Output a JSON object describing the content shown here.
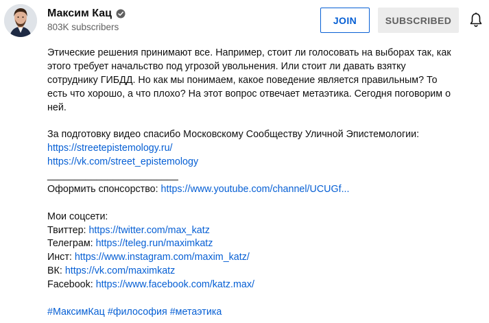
{
  "channel": {
    "name": "Максим Кац",
    "subscribers": "803K subscribers"
  },
  "buttons": {
    "join": "JOIN",
    "subscribed": "SUBSCRIBED"
  },
  "icons": {
    "verified": "verified-check-icon",
    "bell": "bell-icon"
  },
  "colors": {
    "link": "#065fd4",
    "join_border": "#065fd4",
    "subscribed_bg": "#ececec",
    "secondary_text": "#606060"
  },
  "description": {
    "paragraph": [
      "Этические решения принимают все. Например, стоит ли голосовать на выборах так, как",
      "этого требует начальство под угрозой увольнения. Или стоит ли давать взятку",
      "сотруднику ГИБДД. Но как мы понимаем, какое поведение является правильным? То",
      "есть что хорошо, а что плохо? На этот вопрос отвечает метаэтика. Сегодня поговорим о",
      "ней."
    ],
    "thanks": "За подготовку видео спасибо Московскому Сообществу Уличной Эпистемологии:",
    "thanks_links": [
      "https://streetepistemology.ru/",
      "https://vk.com/street_epistemology"
    ],
    "separator": "________________________",
    "sponsor": {
      "label": "Оформить спонсорство: ",
      "link": "https://www.youtube.com/channel/UCUGf..."
    },
    "socials_heading": "Мои соцсети:",
    "socials": [
      {
        "label": "Твиттер: ",
        "link": "https://twitter.com/max_katz"
      },
      {
        "label": "Телеграм: ",
        "link": "https://teleg.run/maximkatz"
      },
      {
        "label": "Инст: ",
        "link": "https://www.instagram.com/maxim_katz/"
      },
      {
        "label": "ВК: ",
        "link": "https://vk.com/maximkatz"
      },
      {
        "label": "Facebook: ",
        "link": "https://www.facebook.com/katz.max/"
      }
    ],
    "hashtags": [
      "#МаксимКац",
      "#философия",
      "#метаэтика"
    ]
  }
}
